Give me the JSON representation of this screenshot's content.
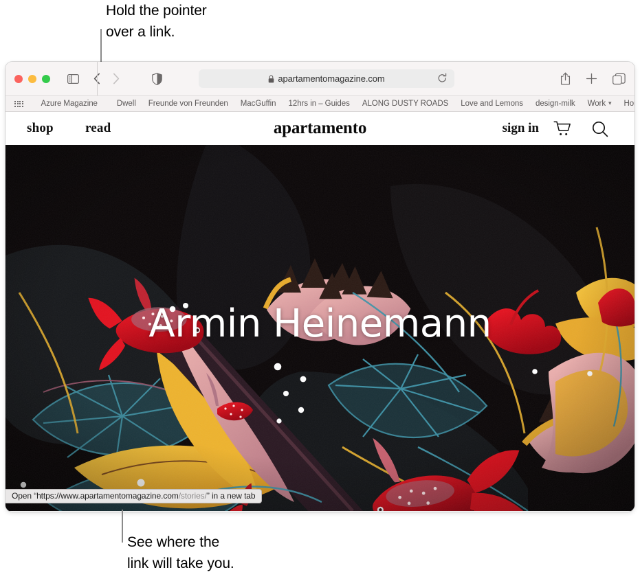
{
  "callouts": {
    "top": "Hold the pointer\nover a link.",
    "bottom": "See where the\nlink will take you."
  },
  "browser": {
    "toolbar": {
      "traffic_lights": [
        "close",
        "minimize",
        "zoom"
      ],
      "sidebar_button": "sidebar-icon",
      "back_button": "chevron-left-icon",
      "forward_button": "chevron-right-icon",
      "shield_button": "privacy-shield-icon",
      "address": {
        "lock": "lock-icon",
        "url": "apartamentomagazine.com",
        "reload": "reload-icon"
      },
      "share_button": "share-icon",
      "new_tab_button": "plus-icon",
      "tab_overview_button": "tab-overview-icon"
    },
    "bookmarks": [
      {
        "label": "Azure Magazine",
        "has_menu": false
      },
      {
        "label": "Dwell",
        "has_menu": false
      },
      {
        "label": "Freunde von Freunden",
        "has_menu": false
      },
      {
        "label": "MacGuffin",
        "has_menu": false
      },
      {
        "label": "12hrs in – Guides",
        "has_menu": false
      },
      {
        "label": "ALONG DUSTY ROADS",
        "has_menu": false
      },
      {
        "label": "Love and Lemons",
        "has_menu": false
      },
      {
        "label": "design-milk",
        "has_menu": false
      },
      {
        "label": "Work",
        "has_menu": true
      },
      {
        "label": "Home",
        "has_menu": true
      }
    ],
    "status_bar": {
      "prefix": "Open “https://www.apartamentomagazine.com",
      "highlight": "/stories/",
      "suffix": "” in a new tab"
    }
  },
  "site": {
    "nav_left": [
      {
        "label": "shop"
      },
      {
        "label": "read"
      }
    ],
    "logo": "apartamento",
    "sign_in": "sign in",
    "cart_icon": "shopping-cart-icon",
    "search_icon": "search-icon",
    "hero_title": "Armin Heinemann"
  },
  "colors": {
    "toolbar_bg": "#f7f4f4",
    "bookmarks_bg": "#f4f1f1",
    "address_bg": "#ececec",
    "hero_bg": "#0a0708",
    "status_bg": "#e9e7e7",
    "accent_red": "#fb635e",
    "accent_yellow": "#fcbc40",
    "accent_green": "#34cb4b"
  }
}
